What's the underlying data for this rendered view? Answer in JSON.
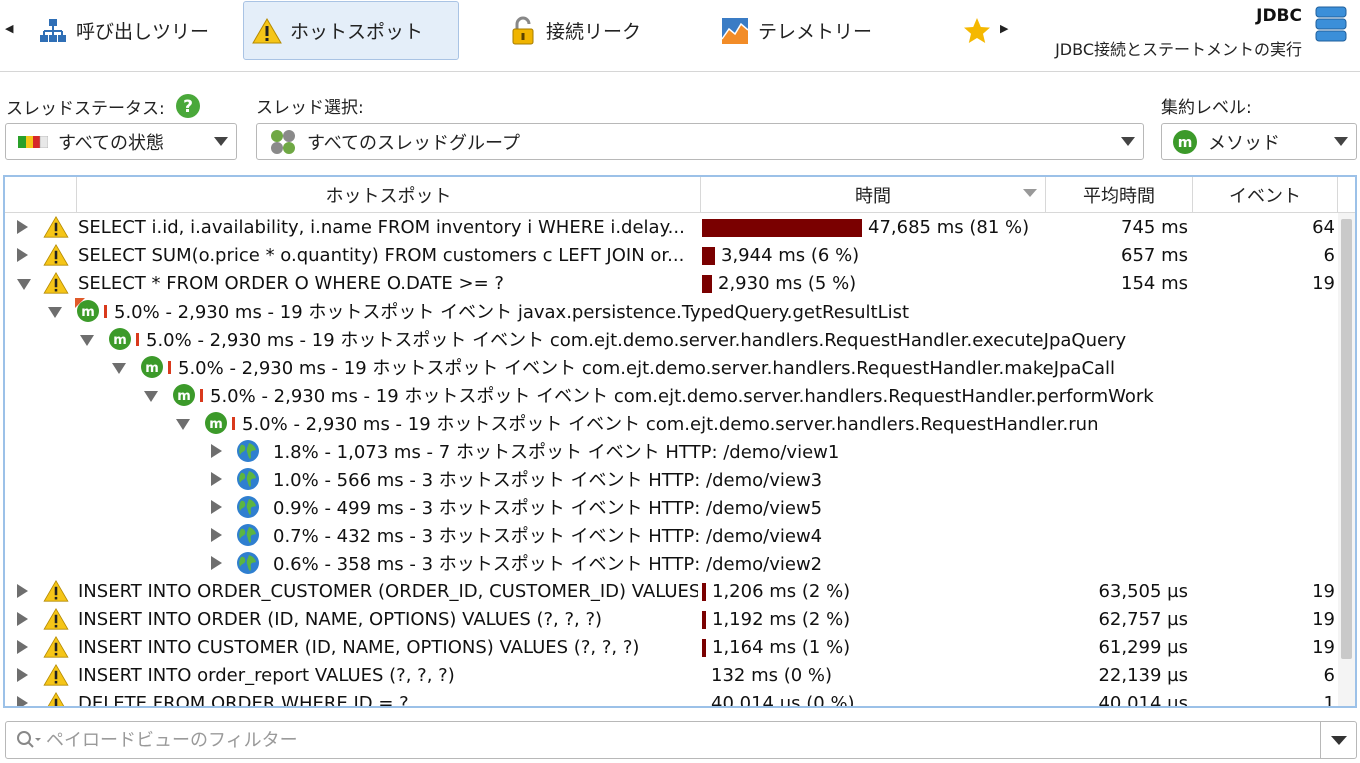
{
  "colors": {
    "accent": "#e4eef9",
    "accent_border": "#a9c3e4",
    "bar": "#7a0000",
    "table_border": "#9cc1e8",
    "warning": "#f5c518",
    "method": "#3c9a2a"
  },
  "topbar": {
    "tabs": [
      {
        "label": "呼び出しツリー",
        "icon": "call-tree-icon"
      },
      {
        "label": "ホットスポット",
        "icon": "warning-icon",
        "active": true
      },
      {
        "label": "接続リーク",
        "icon": "unlock-icon"
      },
      {
        "label": "テレメトリー",
        "icon": "telemetry-icon"
      }
    ],
    "star_icon": "star-icon",
    "probe_title": "JDBC",
    "probe_subtitle": "JDBC接続とステートメントの実行"
  },
  "filters": {
    "thread_status_label": "スレッドステータス:",
    "thread_status_value": "すべての状態",
    "thread_select_label": "スレッド選択:",
    "thread_select_value": "すべてのスレッドグループ",
    "aggregation_label": "集約レベル:",
    "aggregation_value": "メソッド"
  },
  "table": {
    "columns": {
      "hotspot": "ホットスポット",
      "time": "時間",
      "avg": "平均時間",
      "events": "イベント"
    },
    "rows": [
      {
        "text": "SELECT i.id, i.availability, i.name FROM inventory i WHERE i.delay...",
        "time": "47,685 ms (81 %)",
        "avg": "745 ms",
        "events": "64",
        "pct": 0.81
      },
      {
        "text": "SELECT SUM(o.price * o.quantity) FROM customers c LEFT JOIN or...",
        "time": "3,944 ms (6 %)",
        "avg": "657 ms",
        "events": "6",
        "pct": 0.067
      },
      {
        "text": "SELECT * FROM ORDER O WHERE O.DATE >= ?",
        "time": "2,930 ms (5 %)",
        "avg": "154 ms",
        "events": "19",
        "pct": 0.05
      },
      {
        "text": "5.0% - 2,930 ms - 19 ホットスポット イベント javax.persistence.TypedQuery.getResultList"
      },
      {
        "text": "5.0% - 2,930 ms - 19 ホットスポット イベント com.ejt.demo.server.handlers.RequestHandler.executeJpaQuery"
      },
      {
        "text": "5.0% - 2,930 ms - 19 ホットスポット イベント com.ejt.demo.server.handlers.RequestHandler.makeJpaCall"
      },
      {
        "text": "5.0% - 2,930 ms - 19 ホットスポット イベント com.ejt.demo.server.handlers.RequestHandler.performWork"
      },
      {
        "text": "5.0% - 2,930 ms - 19 ホットスポット イベント com.ejt.demo.server.handlers.RequestHandler.run"
      },
      {
        "text": "1.8% - 1,073 ms - 7 ホットスポット イベント HTTP: /demo/view1"
      },
      {
        "text": "1.0% - 566 ms - 3 ホットスポット イベント HTTP: /demo/view3"
      },
      {
        "text": "0.9% - 499 ms - 3 ホットスポット イベント HTTP: /demo/view5"
      },
      {
        "text": "0.7% - 432 ms - 3 ホットスポット イベント HTTP: /demo/view4"
      },
      {
        "text": "0.6% - 358 ms - 3 ホットスポット イベント HTTP: /demo/view2"
      },
      {
        "text": "INSERT INTO ORDER_CUSTOMER (ORDER_ID, CUSTOMER_ID) VALUES (?, ?)",
        "time": "1,206 ms (2 %)",
        "avg": "63,505 µs",
        "events": "19",
        "pct": 0.02
      },
      {
        "text": "INSERT INTO ORDER (ID, NAME, OPTIONS) VALUES (?, ?, ?)",
        "time": "1,192 ms (2 %)",
        "avg": "62,757 µs",
        "events": "19",
        "pct": 0.02
      },
      {
        "text": "INSERT INTO CUSTOMER (ID, NAME, OPTIONS) VALUES (?, ?, ?)",
        "time": "1,164 ms (1 %)",
        "avg": "61,299 µs",
        "events": "19",
        "pct": 0.019
      },
      {
        "text": "INSERT INTO order_report VALUES (?, ?, ?)",
        "time": "132 ms (0 %)",
        "avg": "22,139 µs",
        "events": "6",
        "pct": 0.0
      },
      {
        "text": "DELETE FROM ORDER WHERE ID = ?",
        "time": "40,014 µs (0 %)",
        "avg": "40,014 µs",
        "events": "1",
        "pct": 0.0
      }
    ]
  },
  "bottom_filter": {
    "placeholder": "ペイロードビューのフィルター"
  }
}
